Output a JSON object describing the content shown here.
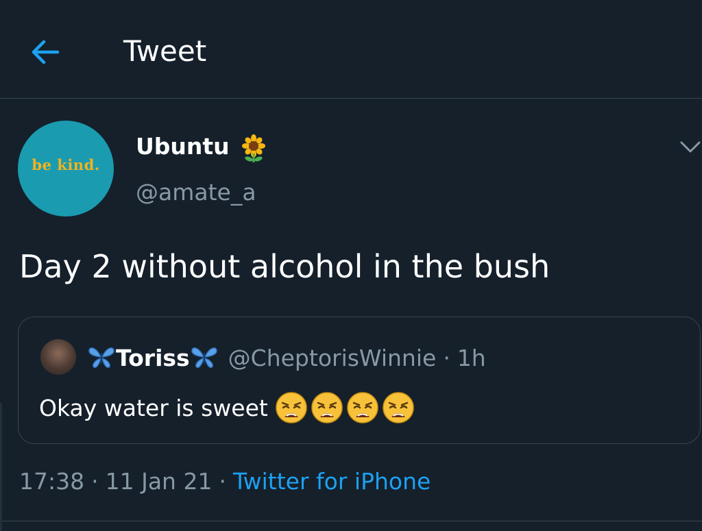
{
  "header": {
    "title": "Tweet",
    "back_icon": "arrow-left-icon"
  },
  "tweet": {
    "avatar_text": "be kind.",
    "display_name": "Ubuntu",
    "name_emoji": "sunflower-icon",
    "handle": "@amate_a",
    "text": "Day 2 without alcohol in the bush",
    "more_icon": "chevron-down-icon"
  },
  "quoted": {
    "display_name": "Toriss",
    "name_decoration": "butterfly-icon",
    "handle": "@CheptorisWinnie",
    "time": "1h",
    "text": "Okay water is sweet",
    "emoji": [
      "weary-face-icon",
      "weary-face-icon",
      "weary-face-icon",
      "weary-face-icon"
    ]
  },
  "meta": {
    "time": "17:38",
    "date": "11 Jan 21",
    "source": "Twitter for iPhone",
    "separator": "·"
  },
  "colors": {
    "background": "#15202b",
    "border": "#38444d",
    "secondary_text": "#8899a6",
    "accent": "#1da1f2",
    "avatar_bg": "#1a9bb0",
    "avatar_text": "#f2b31e"
  }
}
